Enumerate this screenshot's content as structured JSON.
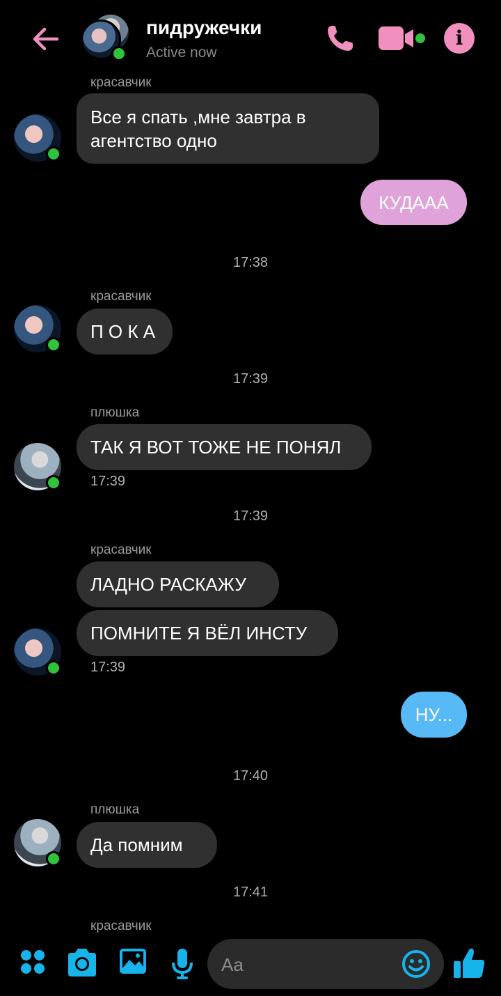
{
  "header": {
    "title": "пидружечки",
    "status": "Active now"
  },
  "messages": {
    "m1": {
      "sender": "красавчик",
      "text": "Все я спать ,мне завтра в\nагентство одно"
    },
    "m2": {
      "text": "КУДААА"
    },
    "t1": "17:38",
    "m3": {
      "sender": "красавчик",
      "text": "П О К А"
    },
    "t2": "17:39",
    "m4": {
      "sender": "плюшка",
      "text": "ТАК Я ВОТ ТОЖЕ НЕ ПОНЯЛ",
      "time": "17:39"
    },
    "t3": "17:39",
    "m5": {
      "sender": "красавчик",
      "text1": "ЛАДНО РАСКАЖУ",
      "text2": "ПОМНИТЕ Я ВЁЛ ИНСТУ",
      "time": "17:39"
    },
    "m6": {
      "text": "НУ..."
    },
    "t4": "17:40",
    "m7": {
      "sender": "плюшка",
      "text": "Да помним"
    },
    "t5": "17:41",
    "m8": {
      "sender": "красавчик"
    }
  },
  "composer": {
    "placeholder": "Aa"
  },
  "colors": {
    "accent_pink": "#f18fbe",
    "accent_blue": "#17b4ec",
    "bubble_incoming": "#303030",
    "bubble_outgoing_pink": "#e0a3d9",
    "bubble_outgoing_blue": "#57b9f5",
    "online_dot": "#31c23c"
  },
  "icons": [
    "back-arrow-icon",
    "phone-icon",
    "video-camera-icon",
    "info-icon",
    "menu-dots-icon",
    "camera-icon",
    "gallery-icon",
    "microphone-icon",
    "emoji-icon",
    "thumbs-up-icon"
  ]
}
